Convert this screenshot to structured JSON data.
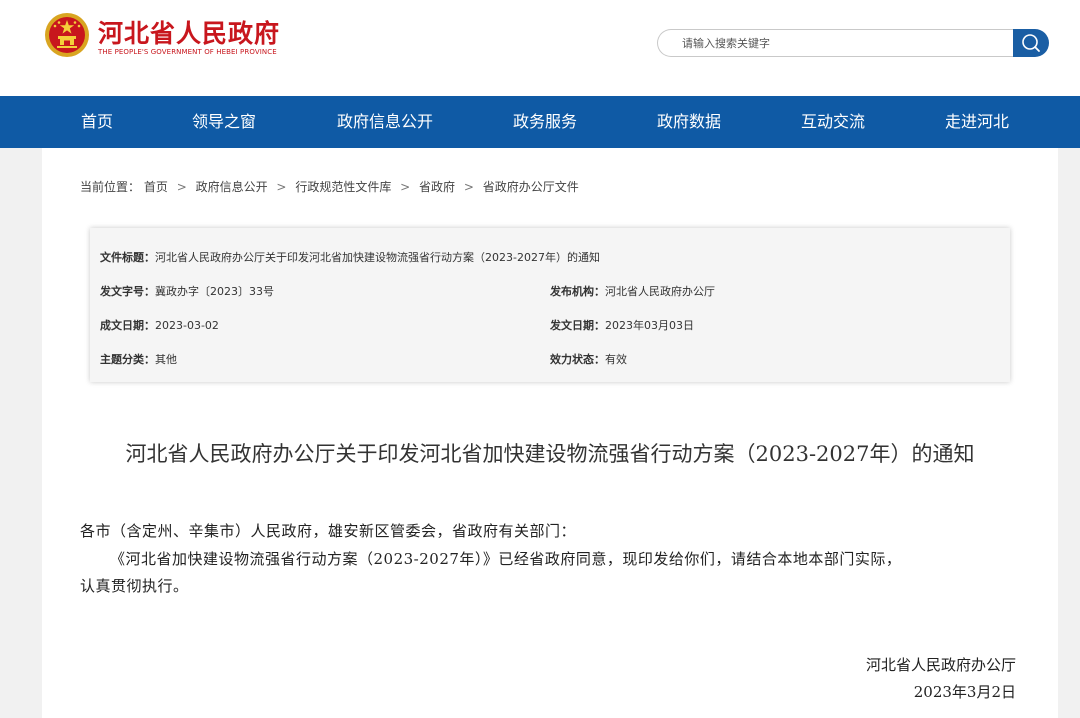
{
  "header": {
    "site_name": "河北省人民政府",
    "site_name_en": "THE PEOPLE'S GOVERNMENT OF HEBEI PROVINCE",
    "emblem_icon": "national-emblem-icon",
    "search_placeholder": "请输入搜索关键字",
    "search_icon": "search-icon"
  },
  "nav": {
    "items": [
      "首页",
      "领导之窗",
      "政府信息公开",
      "政务服务",
      "政府数据",
      "互动交流",
      "走进河北"
    ]
  },
  "breadcrumb": {
    "prefix": "当前位置：",
    "items": [
      "首页",
      "政府信息公开",
      "行政规范性文件库",
      "省政府",
      "省政府办公厅文件"
    ],
    "separator": ">"
  },
  "meta": {
    "title_label": "文件标题：",
    "title_value": "河北省人民政府办公厅关于印发河北省加快建设物流强省行动方案（2023-2027年）的通知",
    "doc_no_label": "发文字号：",
    "doc_no_value": "冀政办字〔2023〕33号",
    "publisher_label": "发布机构：",
    "publisher_value": "河北省人民政府办公厅",
    "created_label": "成文日期：",
    "created_value": "2023-03-02",
    "issued_label": "发文日期：",
    "issued_value": "2023年03月03日",
    "topic_label": "主题分类：",
    "topic_value": "其他",
    "status_label": "效力状态：",
    "status_value": "有效"
  },
  "document": {
    "title": "河北省人民政府办公厅关于印发河北省加快建设物流强省行动方案（2023-2027年）的通知",
    "addressee": "各市（含定州、辛集市）人民政府，雄安新区管委会，省政府有关部门：",
    "body_line1": "《河北省加快建设物流强省行动方案（2023-2027年）》已经省政府同意，现印发给你们，请结合本地本部门实际，",
    "body_line2": "认真贯彻执行。",
    "signature": "河北省人民政府办公厅",
    "date": "2023年3月2日"
  },
  "colors": {
    "brand_red": "#c8161d",
    "nav_blue": "#0f5aa5",
    "search_blue": "#1a5ea4"
  }
}
